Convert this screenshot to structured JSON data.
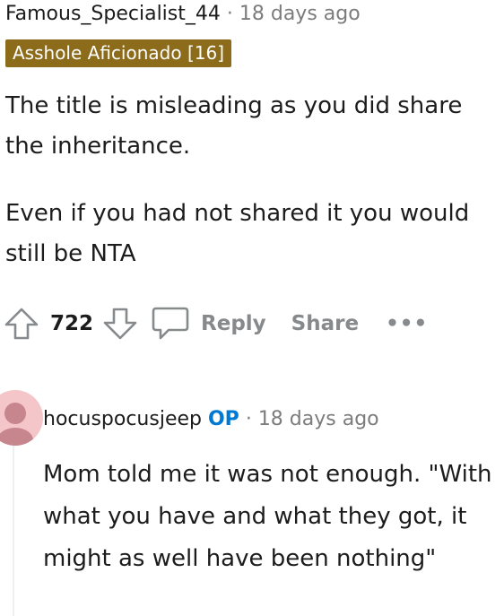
{
  "comment1": {
    "author": "Famous_Specialist_44",
    "separator": "·",
    "time": "18 days ago",
    "flair": "Asshole Aficionado [16]",
    "paragraphs": [
      "The title is misleading as you did share the inheritance.",
      "Even if you had not shared it you would still be NTA"
    ],
    "score": "722",
    "reply_label": "Reply",
    "share_label": "Share",
    "more_label": "•••"
  },
  "comment2": {
    "author": "hocuspocusjeep",
    "badge": "OP",
    "separator": "·",
    "time": "18 days ago",
    "text": "Mom told me it was not enough. \"With what you have and what they got, it might as well have been nothing\""
  },
  "colors": {
    "flair_bg": "#8c6b1a",
    "op_badge": "#0079d3",
    "avatar_bg": "#f4c6c9",
    "meta_gray": "#7c7c7c"
  }
}
